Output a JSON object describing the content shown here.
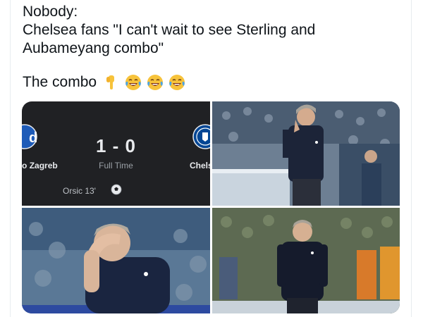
{
  "tweet": {
    "line1": "Nobody:",
    "line2": "Chelsea fans \"I can't wait to see Sterling and",
    "line3": "Aubameyang combo\"",
    "combo_label": "The combo",
    "emojis": [
      "pointing-down-emoji",
      "tears-of-joy-emoji",
      "tears-of-joy-emoji",
      "tears-of-joy-emoji"
    ]
  },
  "scoreboard": {
    "score": "1 - 0",
    "home_team": "Zagreb",
    "home_prefix": "o",
    "away_team": "Chels",
    "status": "Full Time",
    "scorer": "Orsic 13'",
    "colors": {
      "bg": "#202124",
      "home_crest": "#1e5bb8",
      "away_crest": "#034694"
    }
  },
  "photos": [
    {
      "name": "tuchel-head-in-hand-stadium"
    },
    {
      "name": "tuchel-hand-on-face-closeup"
    },
    {
      "name": "tuchel-head-down-walking"
    }
  ]
}
